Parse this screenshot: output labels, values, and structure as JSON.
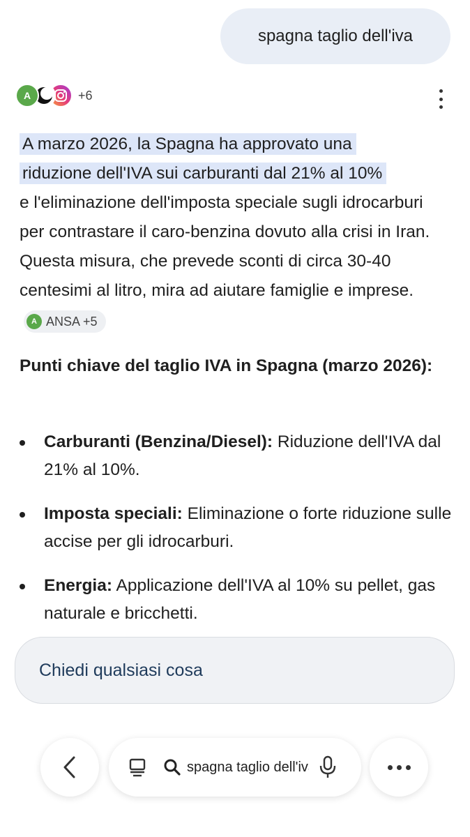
{
  "user_query": "spagna taglio dell'iva",
  "sources": {
    "icons": [
      "ansa-icon",
      "moon-icon",
      "instagram-icon"
    ],
    "ansa_letter": "A",
    "more_count": "+6"
  },
  "answer": {
    "highlight_line1": "A marzo 2026, la Spagna ha approvato una",
    "highlight_line2": "riduzione dell'IVA sui carburanti dal 21% al 10%",
    "rest": "e l'eliminazione dell'imposta speciale sugli idrocarburi per contrastare il caro-benzina dovuto alla crisi in Iran. Questa misura, che prevede sconti di circa 30-40 centesimi al litro, mira ad aiutare famiglie e imprese.",
    "citation_label": "ANSA +5"
  },
  "section_title": "Punti chiave del taglio IVA in Spagna (marzo 2026):",
  "bullets": [
    {
      "title": "Carburanti (Benzina/Diesel):",
      "text": "Riduzione dell'IVA dal 21% al 10%."
    },
    {
      "title": "Imposta speciali:",
      "text": "Eliminazione o forte riduzione sulle accise per gli idrocarburi."
    },
    {
      "title": "Energia:",
      "text": "Applicazione dell'IVA al 10% su pellet, gas naturale e bricchetti."
    }
  ],
  "ask_placeholder": "Chiedi qualsiasi cosa",
  "bottom_bar": {
    "url_text": "spagna taglio dell'iva"
  },
  "colors": {
    "highlight": "#dde6f8",
    "user_bubble": "#e9eef6",
    "ansa_green": "#5aa84a"
  }
}
